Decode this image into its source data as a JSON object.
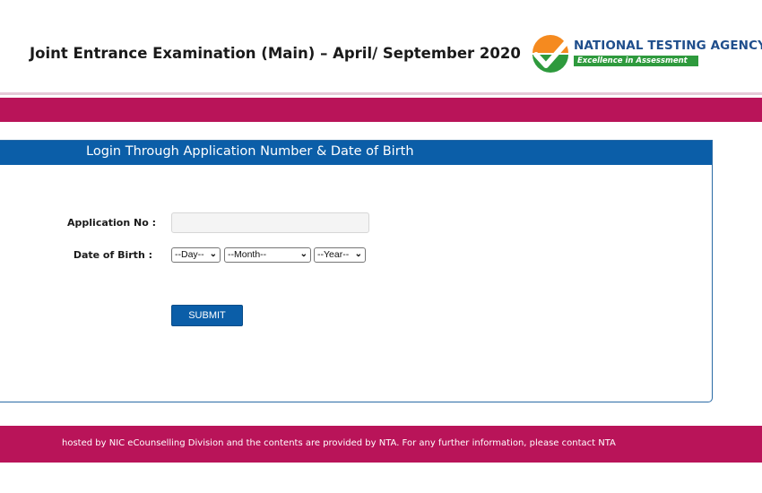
{
  "header": {
    "exam_title": "Joint Entrance Examination (Main) – April/ September 2020",
    "logo_name": "NATIONAL TESTING AGENCY",
    "logo_tagline": "Excellence in Assessment",
    "logo_icon": "nta-checkmark-logo-icon"
  },
  "colors": {
    "brand_band": "#b91459",
    "panel_header": "#0b5ea8",
    "logo_orange": "#f58a1f",
    "logo_green": "#2e9a3d",
    "logo_text": "#1f4e8c"
  },
  "login": {
    "title": "Login Through Application Number & Date of Birth",
    "application_label": "Application No :",
    "application_value": "",
    "application_placeholder": "",
    "dob_label": "Date of Birth :",
    "day_selected": "--Day--",
    "month_selected": "--Month--",
    "year_selected": "--Year--",
    "submit_label": "SUBMIT"
  },
  "footer": {
    "text": "hosted by NIC eCounselling Division and the contents are provided by NTA. For any further information, please contact NTA"
  }
}
